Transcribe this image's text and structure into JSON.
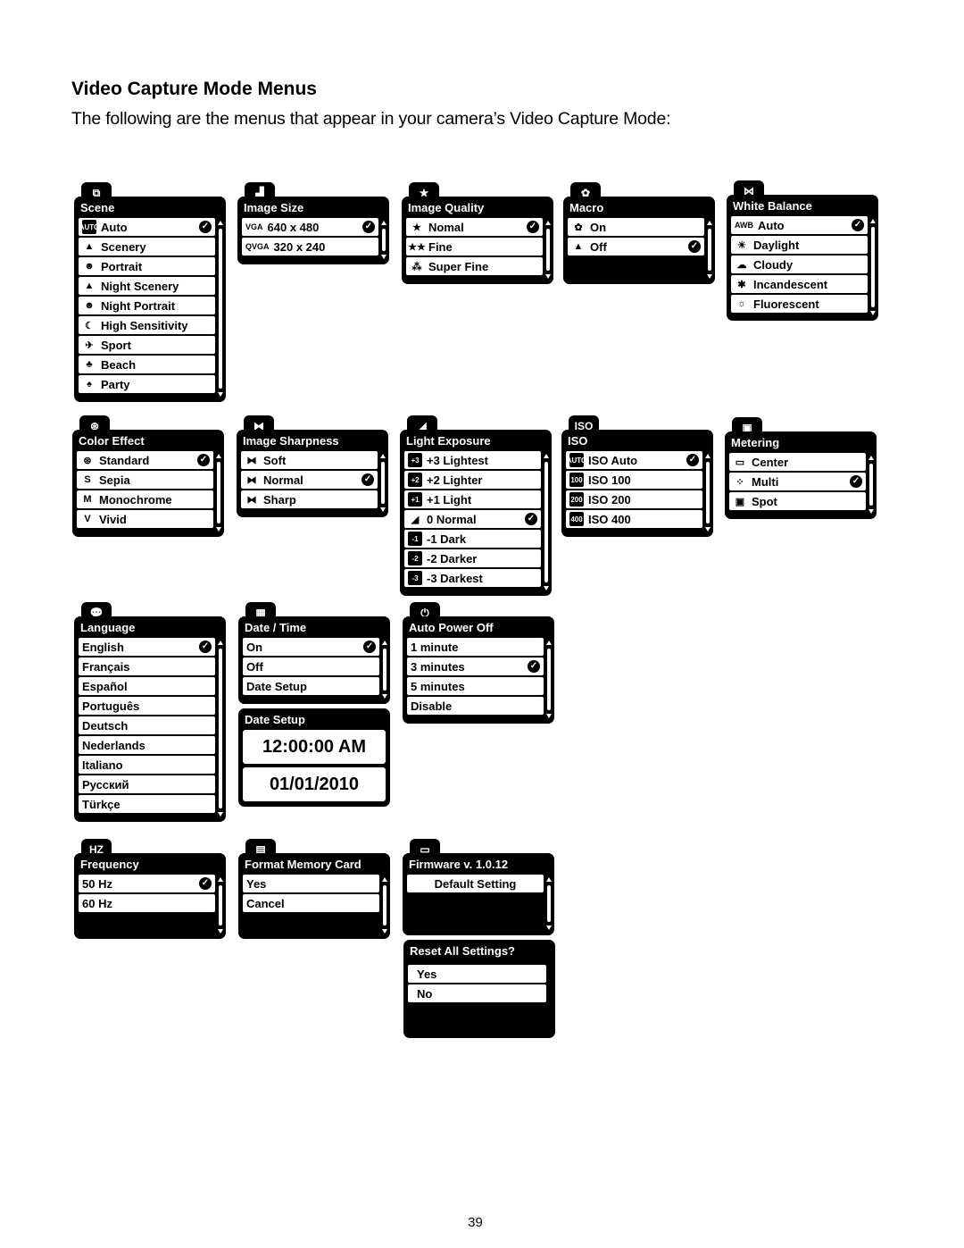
{
  "page": {
    "heading": "Video Capture Mode Menus",
    "intro": "The following are the menus that appear in your camera’s Video Capture Mode:",
    "page_number": "39"
  },
  "menus": {
    "scene": {
      "tab_icon": "scene-icon",
      "title": "Scene",
      "items": [
        {
          "icon": "AUTO",
          "label": "Auto",
          "selected": true
        },
        {
          "icon": "▲",
          "label": "Scenery"
        },
        {
          "icon": "☻",
          "label": "Portrait"
        },
        {
          "icon": "▲",
          "label": "Night Scenery"
        },
        {
          "icon": "☻",
          "label": "Night Portrait"
        },
        {
          "icon": "☾",
          "label": "High Sensitivity"
        },
        {
          "icon": "✈",
          "label": "Sport"
        },
        {
          "icon": "♣",
          "label": "Beach"
        },
        {
          "icon": "♠",
          "label": "Party"
        }
      ]
    },
    "image_size": {
      "tab_icon": "image-size-icon",
      "title": "Image Size",
      "items": [
        {
          "icon": "VGA",
          "label": "640 x 480",
          "selected": true
        },
        {
          "icon": "QVGA",
          "label": "320 x 240"
        }
      ]
    },
    "image_quality": {
      "tab_icon": "star-icon",
      "title": "Image Quality",
      "items": [
        {
          "icon": "★",
          "label": "Nomal",
          "selected": true
        },
        {
          "icon": "★★",
          "label": "Fine"
        },
        {
          "icon": "⁂",
          "label": "Super Fine"
        }
      ]
    },
    "macro": {
      "tab_icon": "macro-flower-icon",
      "title": "Macro",
      "items": [
        {
          "icon": "✿",
          "label": "On"
        },
        {
          "icon": "▲",
          "label": "Off",
          "selected": true
        }
      ]
    },
    "white_balance": {
      "tab_icon": "white-balance-icon",
      "title": "White Balance",
      "items": [
        {
          "icon": "AWB",
          "label": "Auto",
          "selected": true
        },
        {
          "icon": "☀",
          "label": "Daylight"
        },
        {
          "icon": "☁",
          "label": "Cloudy"
        },
        {
          "icon": "✱",
          "label": "Incandescent"
        },
        {
          "icon": "☼",
          "label": "Fluorescent"
        }
      ]
    },
    "color_effect": {
      "tab_icon": "color-effect-icon",
      "title": "Color Effect",
      "items": [
        {
          "icon": "⊛",
          "label": "Standard",
          "selected": true
        },
        {
          "icon": "S",
          "label": "Sepia"
        },
        {
          "icon": "M",
          "label": "Monochrome"
        },
        {
          "icon": "V",
          "label": "Vivid"
        }
      ]
    },
    "image_sharpness": {
      "tab_icon": "sharpness-icon",
      "title": "Image Sharpness",
      "items": [
        {
          "icon": "⧓",
          "label": "Soft"
        },
        {
          "icon": "⧓",
          "label": "Normal",
          "selected": true
        },
        {
          "icon": "⧓",
          "label": "Sharp"
        }
      ]
    },
    "light_exposure": {
      "tab_icon": "exposure-icon",
      "title": "Light Exposure",
      "items": [
        {
          "icon": "+3",
          "label": "+3 Lightest"
        },
        {
          "icon": "+2",
          "label": "+2 Lighter"
        },
        {
          "icon": "+1",
          "label": "+1 Light"
        },
        {
          "icon": "◢",
          "label": "0 Normal",
          "selected": true
        },
        {
          "icon": "-1",
          "label": "-1 Dark"
        },
        {
          "icon": "-2",
          "label": "-2 Darker"
        },
        {
          "icon": "-3",
          "label": "-3 Darkest"
        }
      ]
    },
    "iso": {
      "tab_icon": "iso-icon",
      "tab_text": "ISO",
      "title": "ISO",
      "items": [
        {
          "icon": "AUTO",
          "label": "ISO Auto",
          "selected": true
        },
        {
          "icon": "100",
          "label": "ISO 100"
        },
        {
          "icon": "200",
          "label": "ISO 200"
        },
        {
          "icon": "400",
          "label": "ISO 400"
        }
      ]
    },
    "metering": {
      "tab_icon": "metering-icon",
      "title": "Metering",
      "items": [
        {
          "icon": "▭",
          "label": "Center"
        },
        {
          "icon": "⁘",
          "label": "Multi",
          "selected": true
        },
        {
          "icon": "▣",
          "label": "Spot"
        }
      ]
    },
    "language": {
      "tab_icon": "language-bubble-icon",
      "title": "Language",
      "items": [
        {
          "label": "English",
          "selected": true
        },
        {
          "label": "Français"
        },
        {
          "label": "Español"
        },
        {
          "label": "Português"
        },
        {
          "label": "Deutsch"
        },
        {
          "label": "Nederlands"
        },
        {
          "label": "Italiano"
        },
        {
          "label": "Русский"
        },
        {
          "label": "Türkçe"
        }
      ]
    },
    "date_time": {
      "tab_icon": "calendar-icon",
      "title": "Date / Time",
      "items": [
        {
          "label": "On",
          "selected": true
        },
        {
          "label": "Off"
        },
        {
          "label": "Date Setup"
        }
      ]
    },
    "date_setup": {
      "title": "Date Setup",
      "time": "12:00:00 AM",
      "date": "01/01/2010"
    },
    "auto_power_off": {
      "tab_icon": "power-icon",
      "title": "Auto Power Off",
      "items": [
        {
          "label": "1 minute"
        },
        {
          "label": "3 minutes",
          "selected": true
        },
        {
          "label": "5 minutes"
        },
        {
          "label": "Disable"
        }
      ]
    },
    "frequency": {
      "tab_icon": "hz-icon",
      "tab_text": "HZ",
      "title": "Frequency",
      "items": [
        {
          "label": "50 Hz",
          "selected": true
        },
        {
          "label": "60 Hz"
        }
      ]
    },
    "format_memory_card": {
      "tab_icon": "sd-card-icon",
      "title": "Format Memory Card",
      "items": [
        {
          "label": "Yes"
        },
        {
          "label": "Cancel"
        }
      ]
    },
    "firmware": {
      "tab_icon": "window-icon",
      "title": "Firmware v. 1.0.12",
      "items": [
        {
          "label": "Default Setting"
        }
      ]
    },
    "reset": {
      "title": "Reset All Settings?",
      "items": [
        {
          "label": "Yes"
        },
        {
          "label": "No"
        }
      ]
    }
  }
}
